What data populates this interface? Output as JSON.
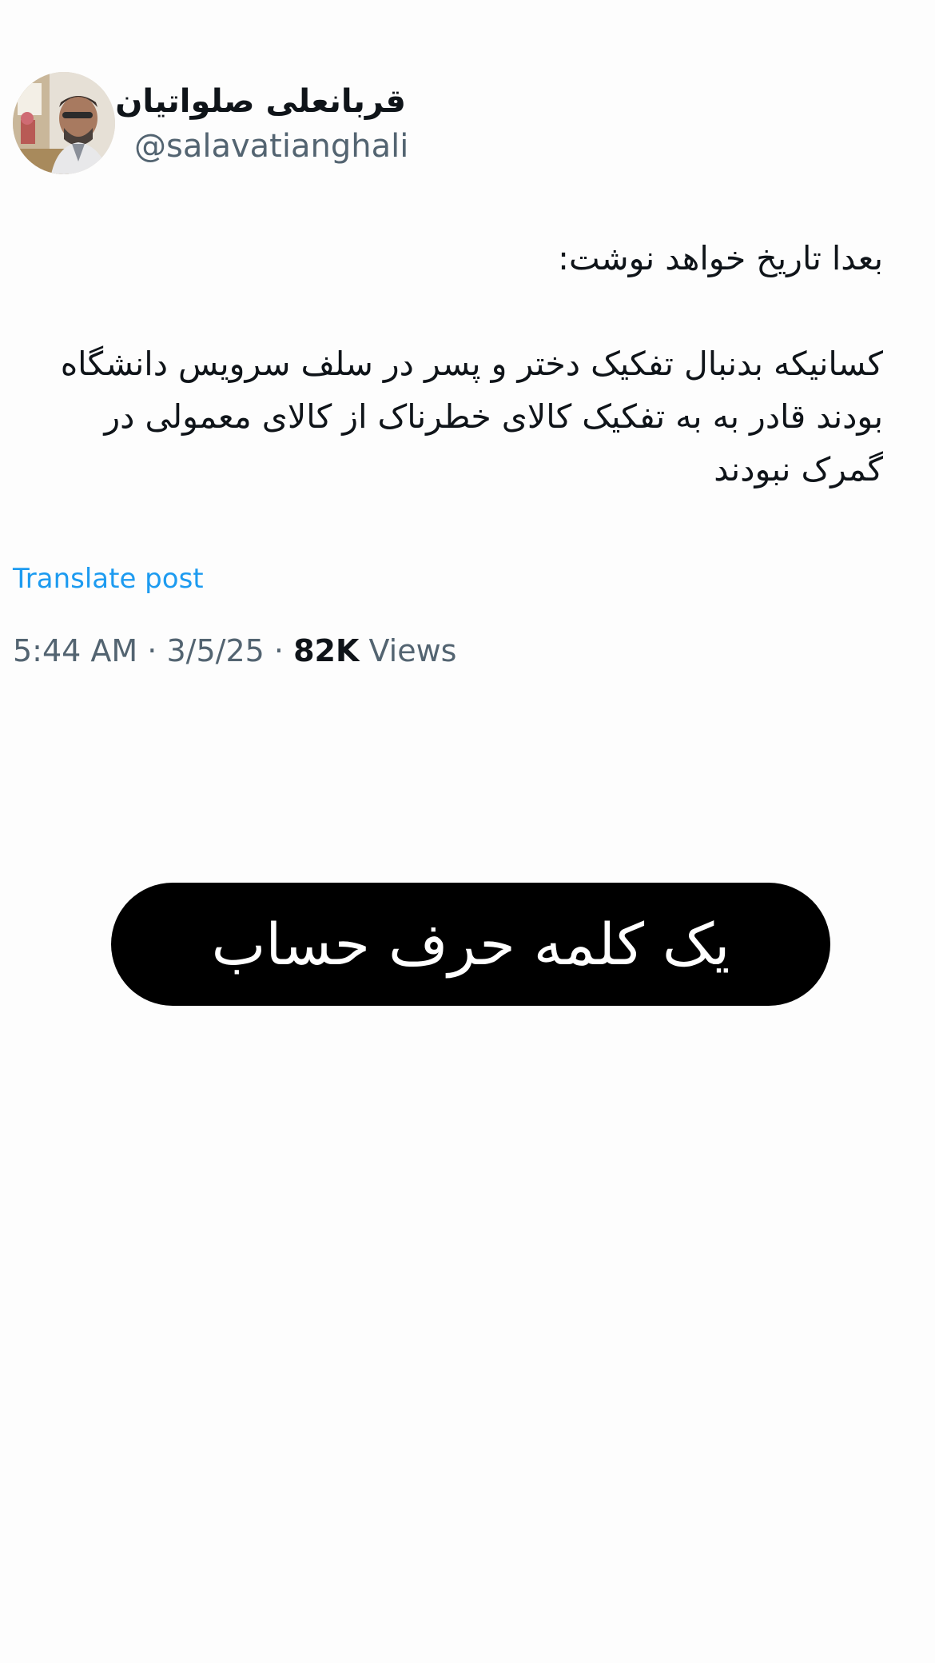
{
  "tweet": {
    "author": {
      "display_name": "قربانعلی صلواتیان",
      "handle": "@salavatianghali",
      "avatar_icon": "profile-photo"
    },
    "text_paragraphs": [
      "بعدا تاریخ خواهد نوشت:",
      "کسانیکه بدنبال تفکیک دختر و پسر در سلف سرویس دانشگاه بودند قادر به به تفکیک کالای خطرناک از کالای معمولی در گمرک نبودند"
    ],
    "translate_label": "Translate post",
    "time": "5:44 AM",
    "date": "3/5/25",
    "separator": "·",
    "views_count": "82K",
    "views_label": "Views",
    "link_color": "#1d9bf0"
  },
  "banner": {
    "text": "یک کلمه حرف حساب",
    "background": "#000000",
    "color": "#ffffff"
  }
}
